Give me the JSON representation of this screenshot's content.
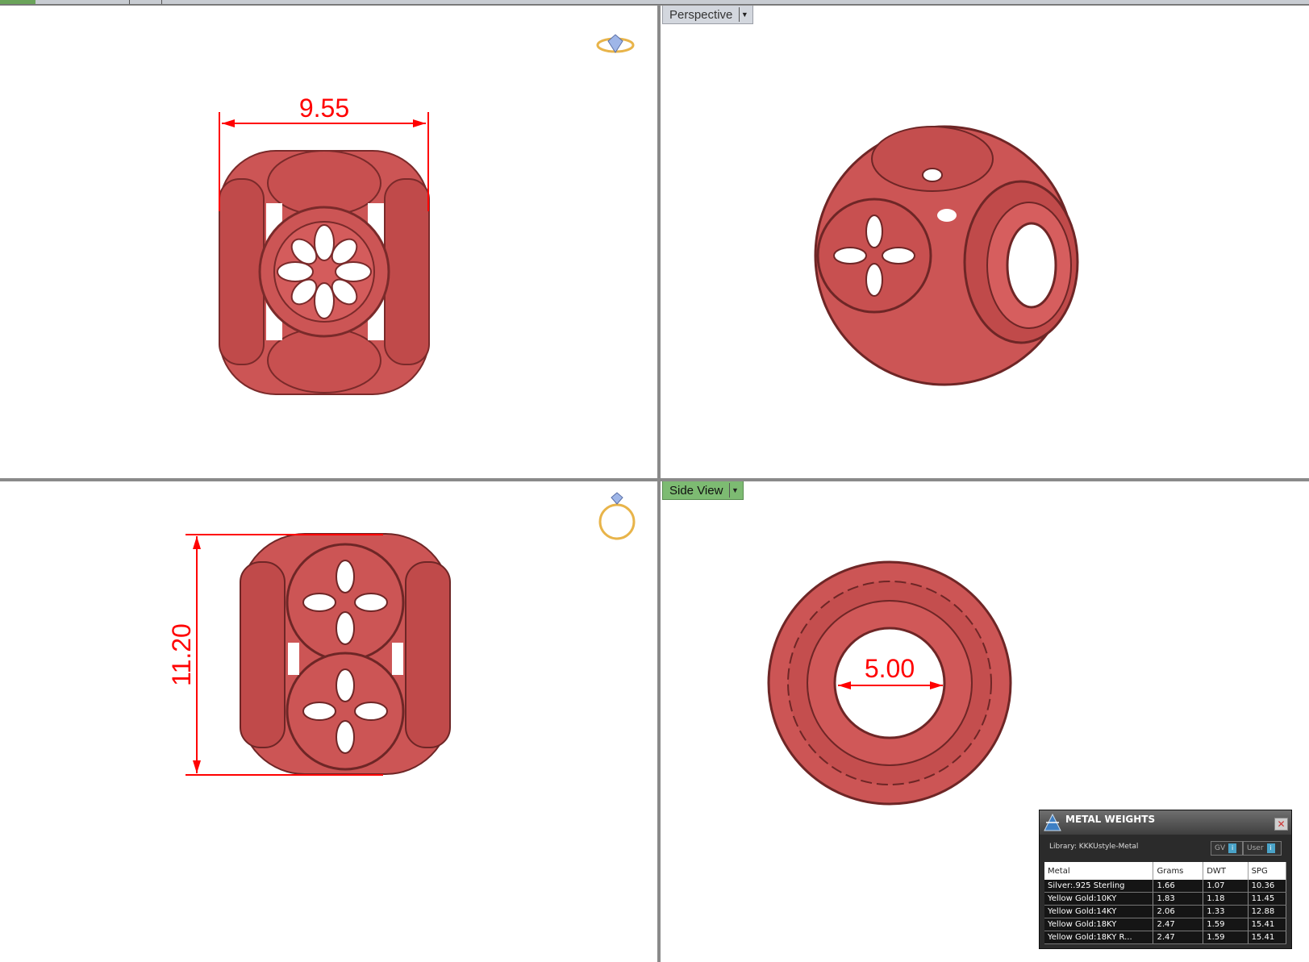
{
  "viewports": {
    "top": {
      "dimension": "9.55"
    },
    "perspective": {
      "label": "Perspective"
    },
    "front": {
      "dimension": "11.20"
    },
    "side": {
      "label": "Side View",
      "dimension": "5.00"
    }
  },
  "colors": {
    "model": "#cc5555",
    "dimension": "#ff0000",
    "accent_green": "#7dbb72"
  },
  "icons": {
    "top_view_icon": "ring-top-icon",
    "front_view_icon": "ring-front-icon"
  },
  "metal_weights": {
    "title": "METAL WEIGHTS",
    "library": "Library: KKKUstyle-Metal",
    "gv_label": "GV",
    "user_label": "User",
    "columns": [
      "Metal",
      "Grams",
      "DWT",
      "SPG"
    ],
    "rows": [
      {
        "metal": "Silver:.925 Sterling",
        "grams": "1.66",
        "dwt": "1.07",
        "spg": "10.36"
      },
      {
        "metal": "Yellow Gold:10KY",
        "grams": "1.83",
        "dwt": "1.18",
        "spg": "11.45"
      },
      {
        "metal": "Yellow Gold:14KY",
        "grams": "2.06",
        "dwt": "1.33",
        "spg": "12.88"
      },
      {
        "metal": "Yellow Gold:18KY",
        "grams": "2.47",
        "dwt": "1.59",
        "spg": "15.41"
      },
      {
        "metal": "Yellow Gold:18KY R...",
        "grams": "2.47",
        "dwt": "1.59",
        "spg": "15.41"
      }
    ]
  }
}
